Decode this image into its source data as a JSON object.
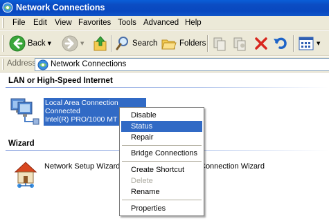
{
  "window": {
    "title": "Network Connections"
  },
  "menu": {
    "items": [
      "File",
      "Edit",
      "View",
      "Favorites",
      "Tools",
      "Advanced",
      "Help"
    ]
  },
  "toolbar": {
    "back_label": "Back",
    "search_label": "Search",
    "folders_label": "Folders"
  },
  "address": {
    "label": "Address",
    "value": "Network Connections"
  },
  "groups": {
    "lan_title": "LAN or High-Speed Internet",
    "wizard_title": "Wizard"
  },
  "connection": {
    "name": "Local Area Connection",
    "status": "Connected",
    "device": "Intel(R) PRO/1000 MT N",
    "selected": true
  },
  "wizards": {
    "setup_label": "Network Setup Wizard",
    "new_connection_partial": "Connection Wizard"
  },
  "context_menu": {
    "items": [
      {
        "label": "Disable",
        "state": "normal"
      },
      {
        "label": "Status",
        "state": "highlighted"
      },
      {
        "label": "Repair",
        "state": "normal"
      },
      {
        "label": "Bridge Connections",
        "state": "normal"
      },
      {
        "label": "Create Shortcut",
        "state": "normal"
      },
      {
        "label": "Delete",
        "state": "disabled"
      },
      {
        "label": "Rename",
        "state": "normal"
      },
      {
        "label": "Properties",
        "state": "normal"
      }
    ]
  },
  "colors": {
    "title_bar": "#0b4cc2",
    "chrome": "#ece9d8",
    "selection": "#316ac5",
    "group_title_line": "#6b8ad7"
  },
  "icons": {
    "title": "network-connections-icon",
    "back": "back-arrow-icon",
    "forward": "forward-arrow-icon",
    "up": "up-folder-icon",
    "search": "search-icon",
    "folders": "folders-icon",
    "move_to": "move-to-icon",
    "copy_to": "copy-to-icon",
    "delete": "delete-x-icon",
    "undo": "undo-icon",
    "views": "views-icon",
    "lan_connection": "lan-connection-icon",
    "setup_wizard": "network-setup-wizard-icon"
  }
}
